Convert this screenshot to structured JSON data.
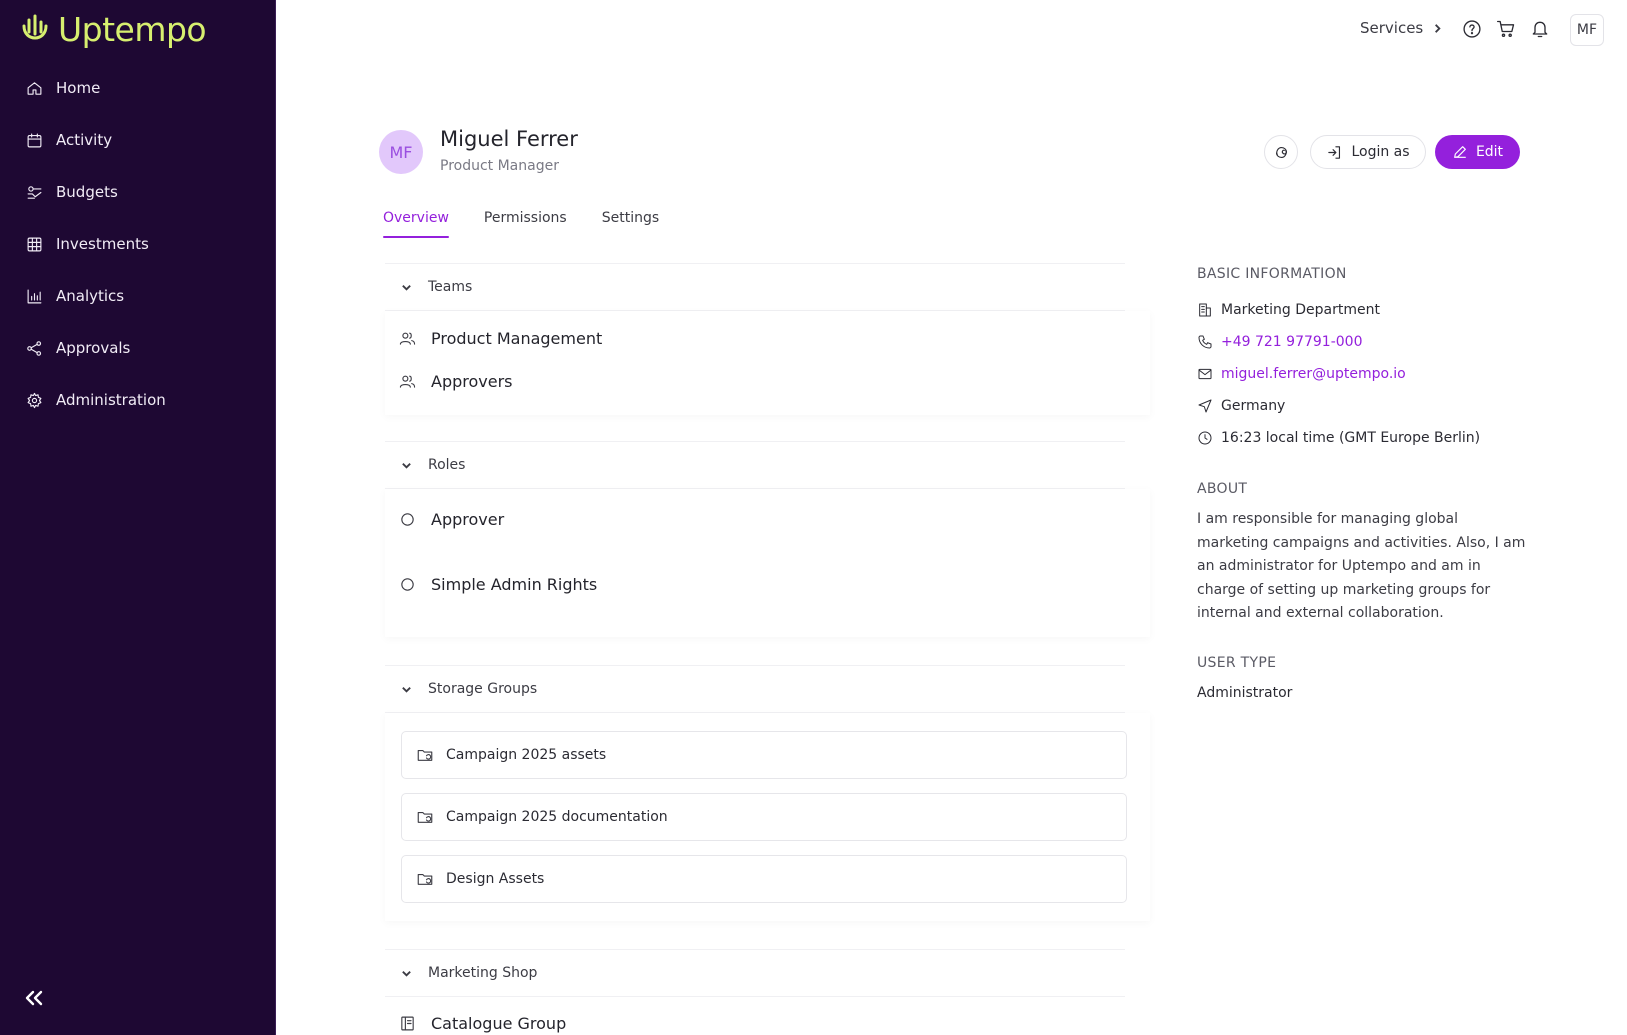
{
  "brand": {
    "name": "Uptempo",
    "logo_color": "#d7ef6f",
    "accent": "#9420dc",
    "sidebar_bg": "#1e0833"
  },
  "sidebar": {
    "items": [
      {
        "label": "Home",
        "icon": "home-icon"
      },
      {
        "label": "Activity",
        "icon": "calendar-icon"
      },
      {
        "label": "Budgets",
        "icon": "budget-icon"
      },
      {
        "label": "Investments",
        "icon": "grid-table-icon"
      },
      {
        "label": "Analytics",
        "icon": "bar-chart-icon"
      },
      {
        "label": "Approvals",
        "icon": "share-nodes-icon"
      },
      {
        "label": "Administration",
        "icon": "gear-icon"
      }
    ],
    "collapse_icon": "double-chevron-left-icon"
  },
  "topbar": {
    "services_label": "Services",
    "avatar_initials": "MF",
    "icons": [
      "help-circle-icon",
      "cart-icon",
      "bell-icon"
    ]
  },
  "profile": {
    "initials": "MF",
    "name": "Miguel Ferrer",
    "role": "Product Manager",
    "login_as_label": "Login as",
    "edit_label": "Edit"
  },
  "tabs": [
    {
      "label": "Overview",
      "active": true
    },
    {
      "label": "Permissions",
      "active": false
    },
    {
      "label": "Settings",
      "active": false
    }
  ],
  "sections": {
    "teams": {
      "title": "Teams",
      "items": [
        "Product Management",
        "Approvers"
      ]
    },
    "roles": {
      "title": "Roles",
      "items": [
        "Approver",
        "Simple Admin Rights"
      ]
    },
    "storage_groups": {
      "title": "Storage Groups",
      "items": [
        "Campaign 2025 assets",
        "Campaign 2025 documentation",
        "Design Assets"
      ]
    },
    "marketing_shop": {
      "title": "Marketing Shop",
      "items": [
        "Catalogue Group"
      ]
    }
  },
  "basic_info": {
    "title": "BASIC INFORMATION",
    "department": "Marketing Department",
    "phone": "+49 721 97791-000",
    "email": "miguel.ferrer@uptempo.io",
    "country": "Germany",
    "local_time": "16:23 local time (GMT Europe Berlin)"
  },
  "about": {
    "title": "ABOUT",
    "text": "I am responsible for managing global marketing campaigns and activities. Also, I am an administrator for Uptempo and am in charge of setting up marketing groups for internal and external collaboration."
  },
  "user_type": {
    "title": "USER TYPE",
    "value": "Administrator"
  }
}
